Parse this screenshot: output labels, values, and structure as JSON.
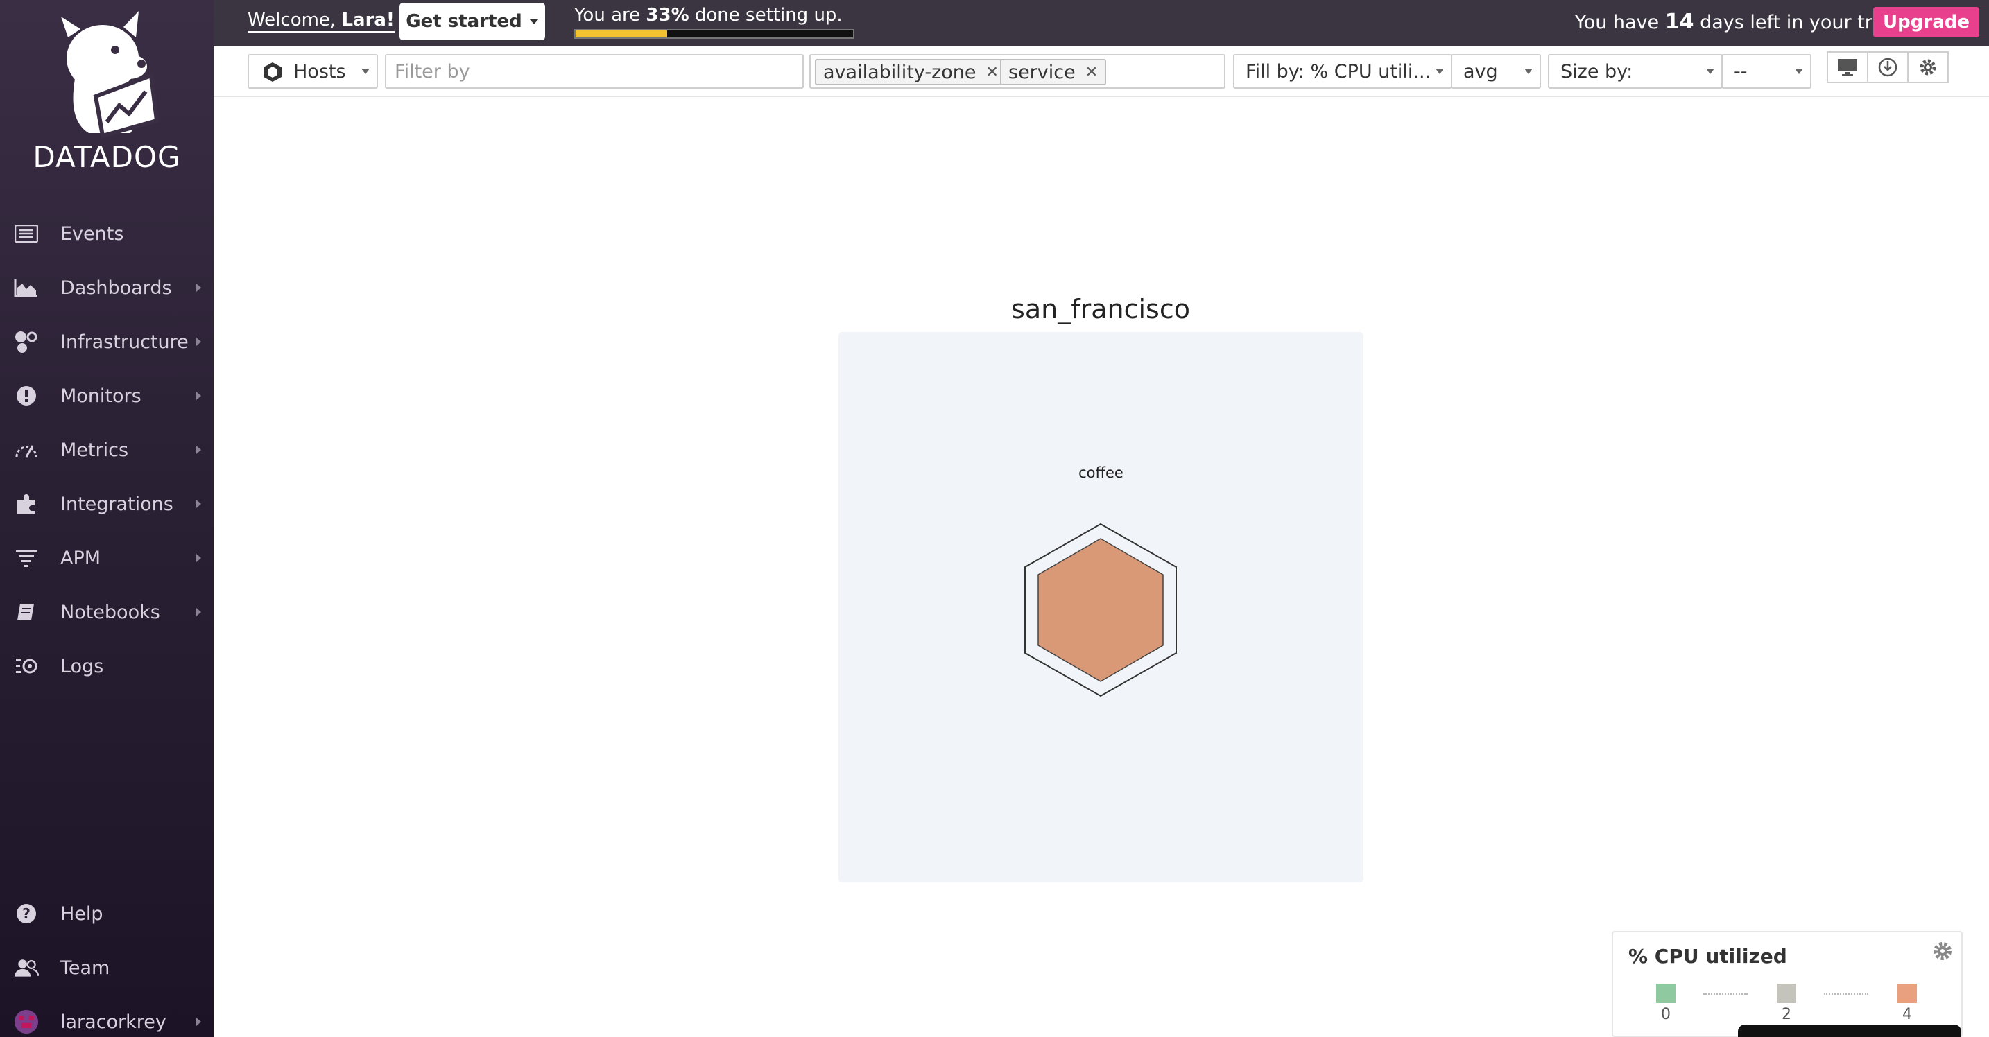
{
  "sidebar": {
    "logo_text": "DATADOG",
    "items": [
      {
        "label": "Events",
        "icon": "list-icon",
        "arrow": false
      },
      {
        "label": "Dashboards",
        "icon": "area-chart-icon",
        "arrow": true
      },
      {
        "label": "Infrastructure",
        "icon": "hexagons-icon",
        "arrow": true
      },
      {
        "label": "Monitors",
        "icon": "alert-circle-icon",
        "arrow": true
      },
      {
        "label": "Metrics",
        "icon": "gauge-icon",
        "arrow": true
      },
      {
        "label": "Integrations",
        "icon": "puzzle-icon",
        "arrow": true
      },
      {
        "label": "APM",
        "icon": "filter-lines-icon",
        "arrow": true
      },
      {
        "label": "Notebooks",
        "icon": "notebook-icon",
        "arrow": true
      },
      {
        "label": "Logs",
        "icon": "logs-icon",
        "arrow": false
      }
    ],
    "bottom_items": [
      {
        "label": "Help",
        "icon": "question-circle-icon",
        "arrow": false
      },
      {
        "label": "Team",
        "icon": "users-icon",
        "arrow": false
      },
      {
        "label": "laracorkrey",
        "icon": "avatar",
        "arrow": true
      }
    ]
  },
  "topbar": {
    "welcome_prefix": "Welcome, ",
    "welcome_name": "Lara!",
    "get_started_label": "Get started",
    "progress_prefix": "You are ",
    "progress_percent": "33%",
    "progress_suffix": " done setting up.",
    "progress_fraction": 0.33,
    "trial_prefix": "You have ",
    "trial_days": "14",
    "trial_suffix": " days left in your trial.",
    "upgrade_label": "Upgrade"
  },
  "toolbar": {
    "view_select": "Hosts",
    "filter_placeholder": "Filter by",
    "group_tags": [
      "availability-zone",
      "service"
    ],
    "fill_by": "Fill by: % CPU utili...",
    "aggregation": "avg",
    "size_by": "Size by:",
    "size_value": "--"
  },
  "map": {
    "group_title": "san_francisco",
    "host_label": "coffee",
    "host_fill_color": "#d99876"
  },
  "legend": {
    "title": "% CPU utilized",
    "ticks": [
      "0",
      "2",
      "4"
    ],
    "colors": [
      "#8fc9a0",
      "#c4c4bc",
      "#e8a07e"
    ]
  }
}
